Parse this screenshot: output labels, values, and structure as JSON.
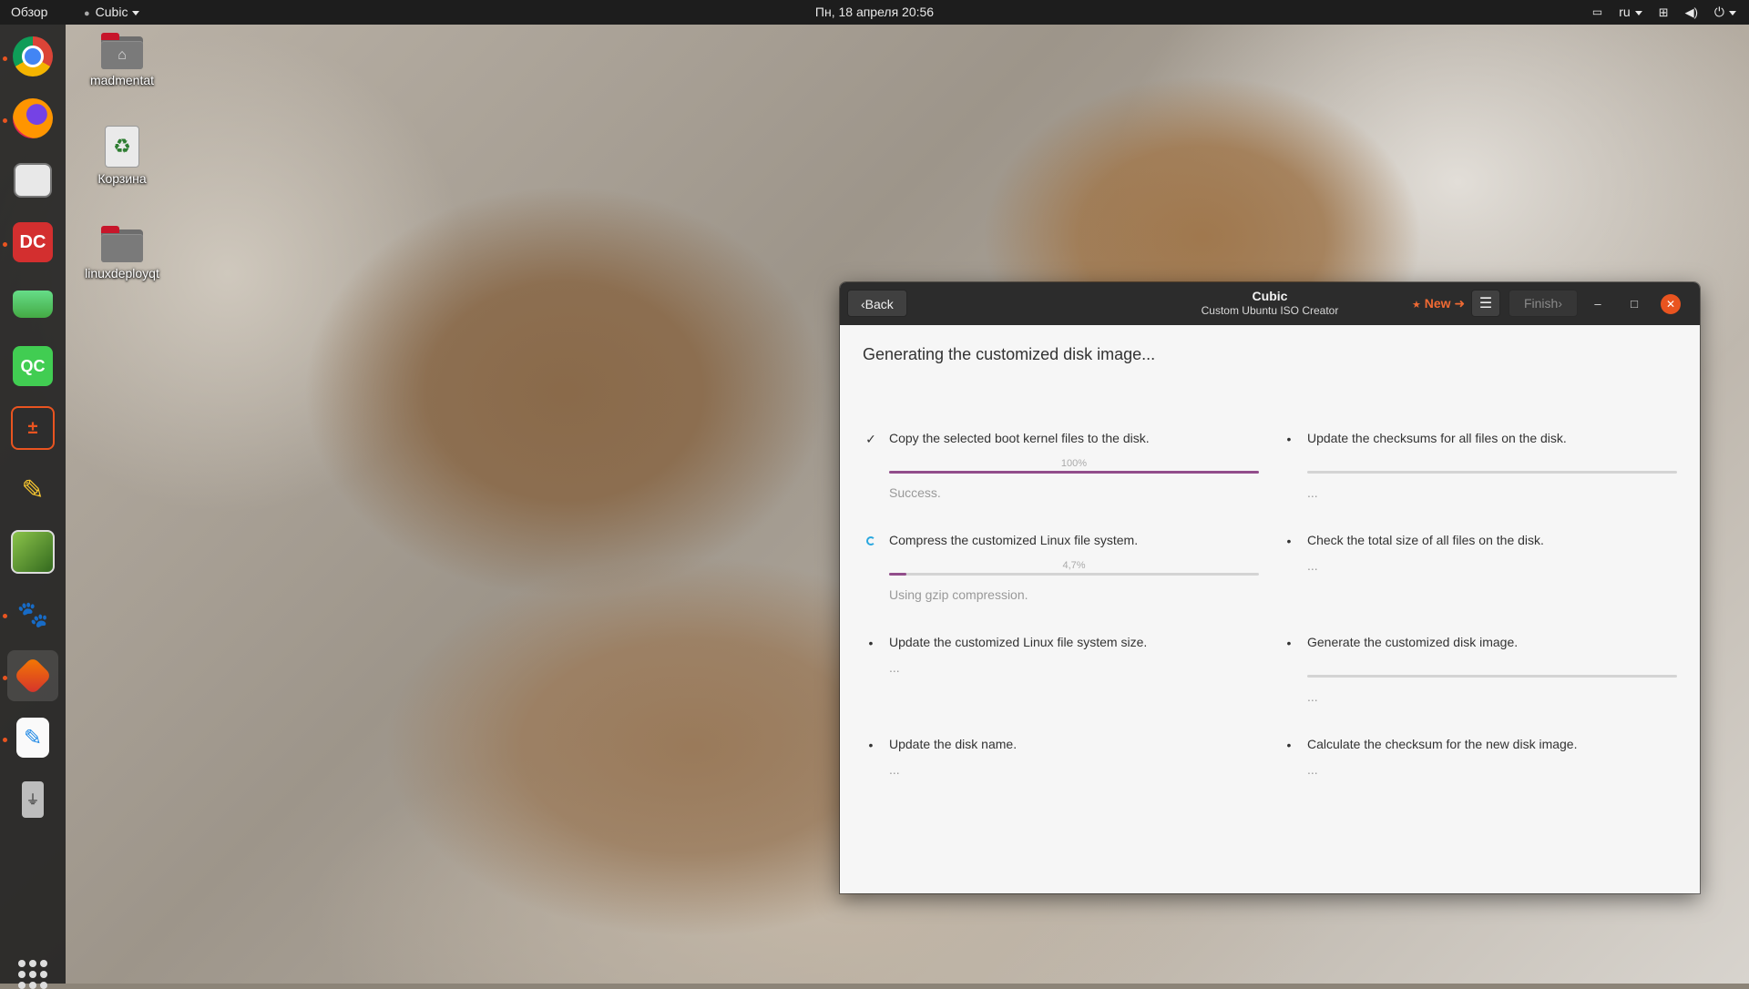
{
  "topbar": {
    "overview": "Обзор",
    "app_menu": "Cubic",
    "clock": "Пн, 18 апреля  20:56",
    "language": "ru"
  },
  "desktop": {
    "icons": [
      {
        "label": "madmentat"
      },
      {
        "label": "Корзина"
      },
      {
        "label": "linuxdeployqt"
      }
    ]
  },
  "dock": {
    "items": [
      {
        "name": "chrome"
      },
      {
        "name": "firefox"
      },
      {
        "name": "files"
      },
      {
        "name": "doublecmd"
      },
      {
        "name": "disk-usage"
      },
      {
        "name": "qt-creator"
      },
      {
        "name": "plus-minus-app"
      },
      {
        "name": "text-editor-pen"
      },
      {
        "name": "image-app"
      },
      {
        "name": "gimp"
      },
      {
        "name": "cubic"
      },
      {
        "name": "text-editor"
      },
      {
        "name": "usb-drive"
      }
    ]
  },
  "window": {
    "title": "Cubic",
    "subtitle": "Custom Ubuntu ISO Creator",
    "back_label": "Back",
    "new_label": "New",
    "finish_label": "Finish",
    "heading": "Generating the customized disk image...",
    "steps_left": [
      {
        "label": "Copy the selected boot kernel files to the disk.",
        "progress_text": "100%",
        "progress": 1.0,
        "status": "Success.",
        "state": "done"
      },
      {
        "label": "Compress the customized Linux file system.",
        "progress_text": "4,7%",
        "progress": 0.047,
        "status": "Using gzip compression.",
        "state": "running"
      },
      {
        "label": "Update the customized Linux file system size.",
        "status": "...",
        "state": "pending"
      },
      {
        "label": "Update the disk name.",
        "status": "...",
        "state": "pending"
      }
    ],
    "steps_right": [
      {
        "label": "Update the checksums for all files on the disk.",
        "status": "...",
        "state": "pending",
        "progress": 0
      },
      {
        "label": "Check the total size of all files on the disk.",
        "status": "...",
        "state": "pending"
      },
      {
        "label": "Generate the customized disk image.",
        "status": "...",
        "state": "pending",
        "progress": 0
      },
      {
        "label": "Calculate the checksum for the new disk image.",
        "status": "...",
        "state": "pending"
      }
    ]
  },
  "colors": {
    "accent": "#e95420",
    "progress": "#924d8b",
    "spinner": "#29a7df"
  }
}
